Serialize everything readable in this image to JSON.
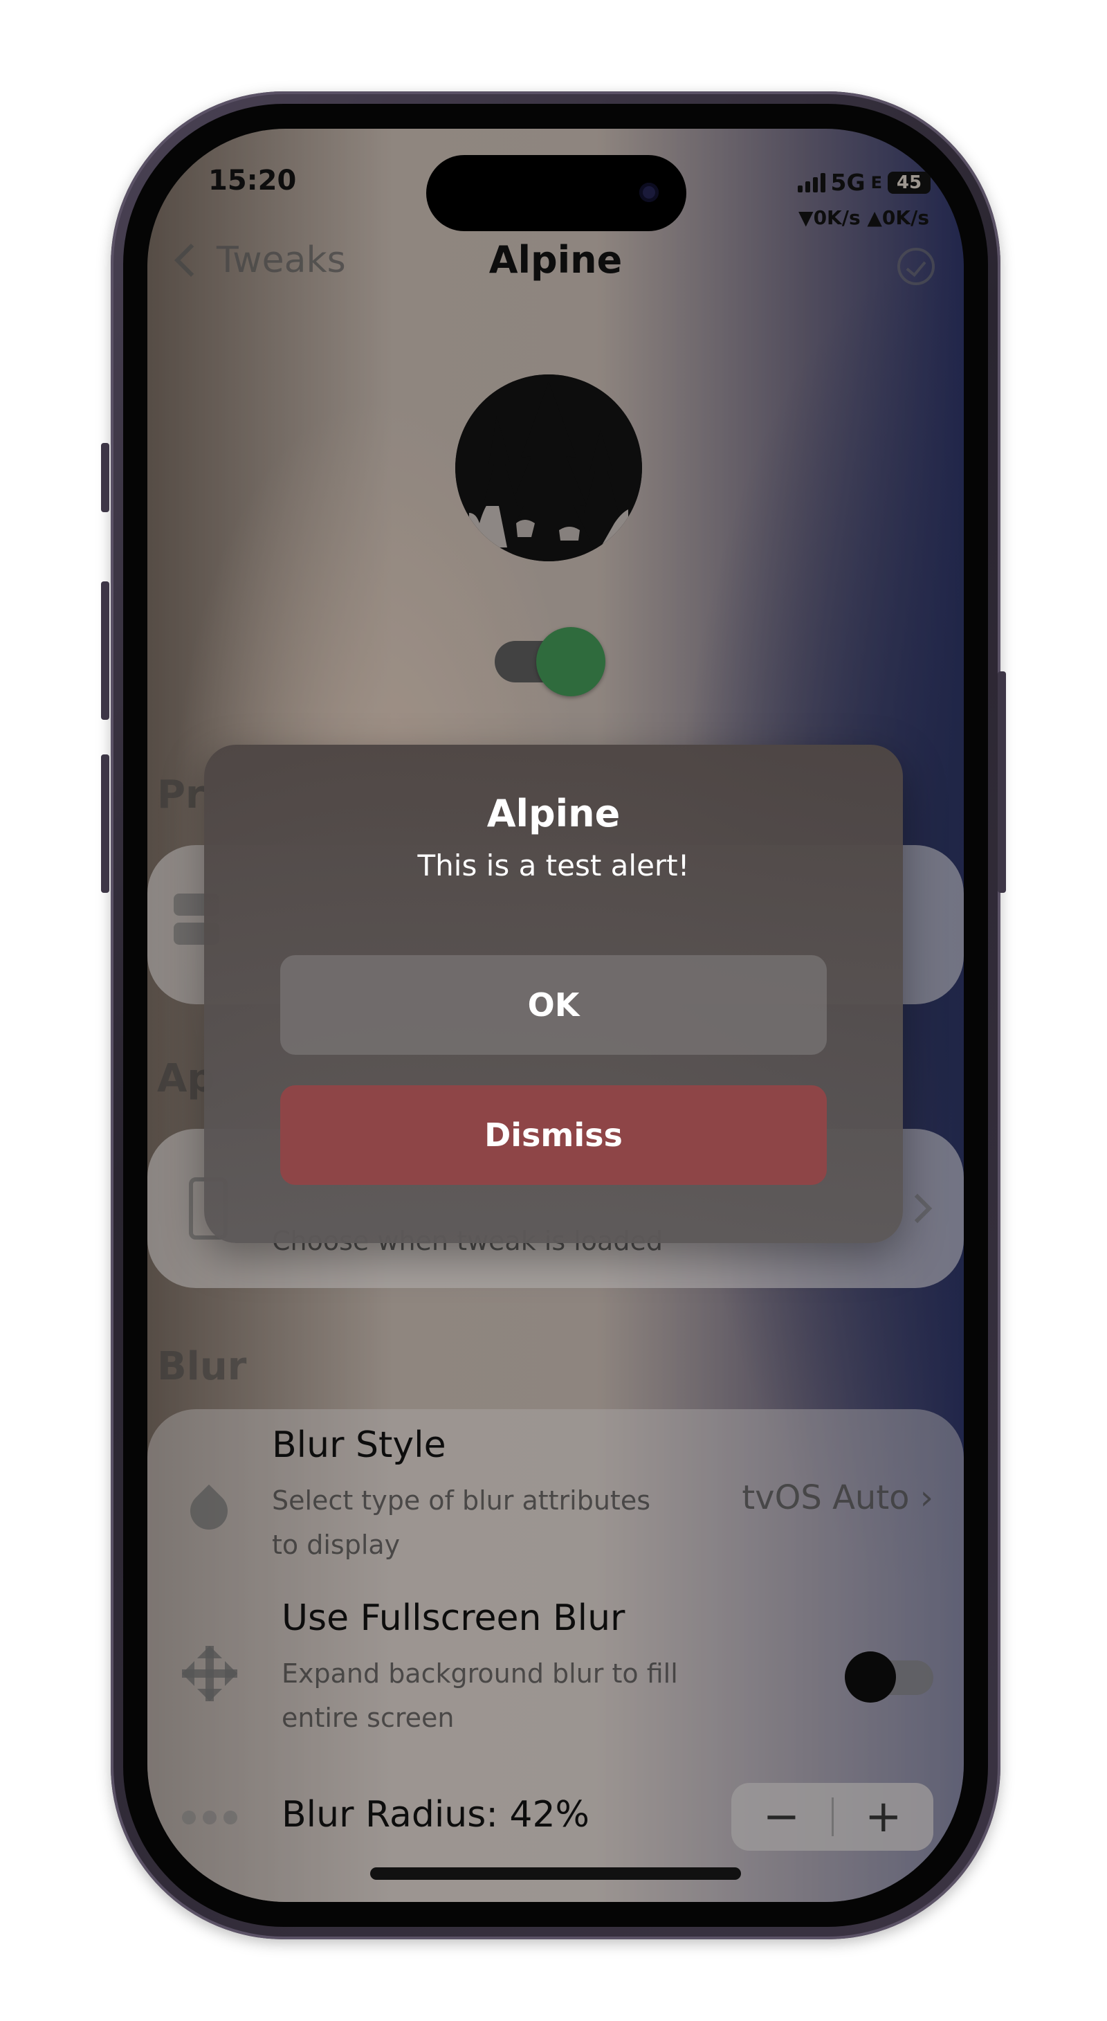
{
  "status_bar": {
    "time": "15:20",
    "network": "5G",
    "network_suffix": "E",
    "battery": "45",
    "speed": "▼0K/s ▲0K/s"
  },
  "nav": {
    "back_label": "Tweaks",
    "title": "Alpine"
  },
  "main_toggle": {
    "on": true
  },
  "sections": {
    "pr_fragment": "Pr",
    "ap_fragment": "Ap",
    "blur_header": "Blur"
  },
  "appearance_row": {
    "subtitle": "Choose when tweak is loaded"
  },
  "blur": {
    "style_title": "Blur Style",
    "style_subtitle_line1": "Select type of blur attributes",
    "style_subtitle_line2": "to display",
    "style_value": "tvOS Auto ›",
    "fullscreen_title": "Use Fullscreen Blur",
    "fullscreen_subtitle_line1": "Expand background blur to fill",
    "fullscreen_subtitle_line2": "entire screen",
    "fullscreen_on": false,
    "radius_label": "Blur Radius: 42%",
    "stepper_minus": "−",
    "stepper_plus": "+"
  },
  "alert": {
    "title": "Alpine",
    "message": "This is a test alert!",
    "ok_label": "OK",
    "dismiss_label": "Dismiss"
  },
  "colors": {
    "toggle_on": "#3d8a4f",
    "dismiss": "#8e4547"
  }
}
